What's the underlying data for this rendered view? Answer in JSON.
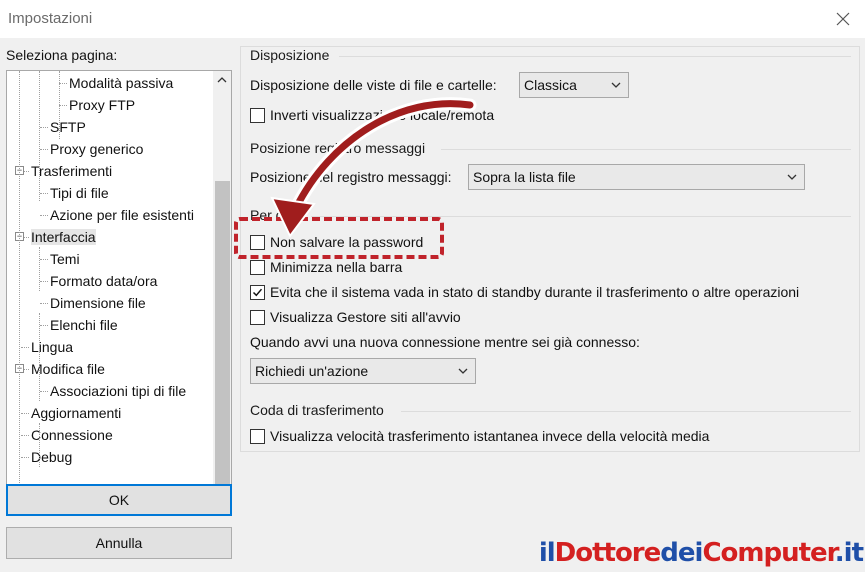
{
  "window": {
    "title": "Impostazioni"
  },
  "left": {
    "label": "Seleziona pagina:",
    "tree": [
      {
        "label": "Modalità passiva"
      },
      {
        "label": "Proxy FTP"
      },
      {
        "label": "SFTP"
      },
      {
        "label": "Proxy generico"
      },
      {
        "label": "Trasferimenti",
        "expander": "−"
      },
      {
        "label": "Tipi di file"
      },
      {
        "label": "Azione per file esistenti"
      },
      {
        "label": "Interfaccia",
        "expander": "−",
        "selected": true
      },
      {
        "label": "Temi"
      },
      {
        "label": "Formato data/ora"
      },
      {
        "label": "Dimensione file"
      },
      {
        "label": "Elenchi file"
      },
      {
        "label": "Lingua"
      },
      {
        "label": "Modifica file",
        "expander": "−"
      },
      {
        "label": "Associazioni tipi di file"
      },
      {
        "label": "Aggiornamenti"
      },
      {
        "label": "Connessione"
      },
      {
        "label": "Debug"
      }
    ],
    "ok_label": "OK",
    "cancel_label": "Annulla"
  },
  "layout_group": {
    "title": "Disposizione",
    "view_label": "Disposizione delle viste di file e cartelle:",
    "view_value": "Classica",
    "invert_label": "Inverti visualizzazione locale/remota",
    "invert_checked": false
  },
  "log_group": {
    "title": "Posizione registro messaggi",
    "position_label": "Posizione del registro messaggi:",
    "position_value": "Sopra la lista file"
  },
  "other_group": {
    "title": "Per ora",
    "no_save_password": {
      "label": "Non salvare la password",
      "checked": false
    },
    "minimize_tray": {
      "label": "Minimizza nella barra",
      "checked": false
    },
    "prevent_standby": {
      "label": "Evita che il sistema vada in stato di standby durante il trasferimento o altre operazioni",
      "checked": true
    },
    "show_site_manager": {
      "label": "Visualizza Gestore siti all'avvio",
      "checked": false
    },
    "new_connection_label": "Quando avvi una nuova connessione mentre sei già connesso:",
    "new_connection_value": "Richiedi un'azione"
  },
  "queue_group": {
    "title": "Coda di trasferimento",
    "speed_label": "Visualizza velocità trasferimento istantanea invece della velocità media",
    "speed_checked": false
  },
  "watermark": {
    "parts": [
      "il",
      "Dottore",
      "dei",
      "Computer",
      ".it"
    ],
    "colors": [
      "#1f4fa8",
      "#d42020",
      "#1f4fa8",
      "#d42020",
      "#1f4fa8"
    ]
  },
  "colors": {
    "highlight": "#c0232b",
    "focus": "#0078d7"
  }
}
